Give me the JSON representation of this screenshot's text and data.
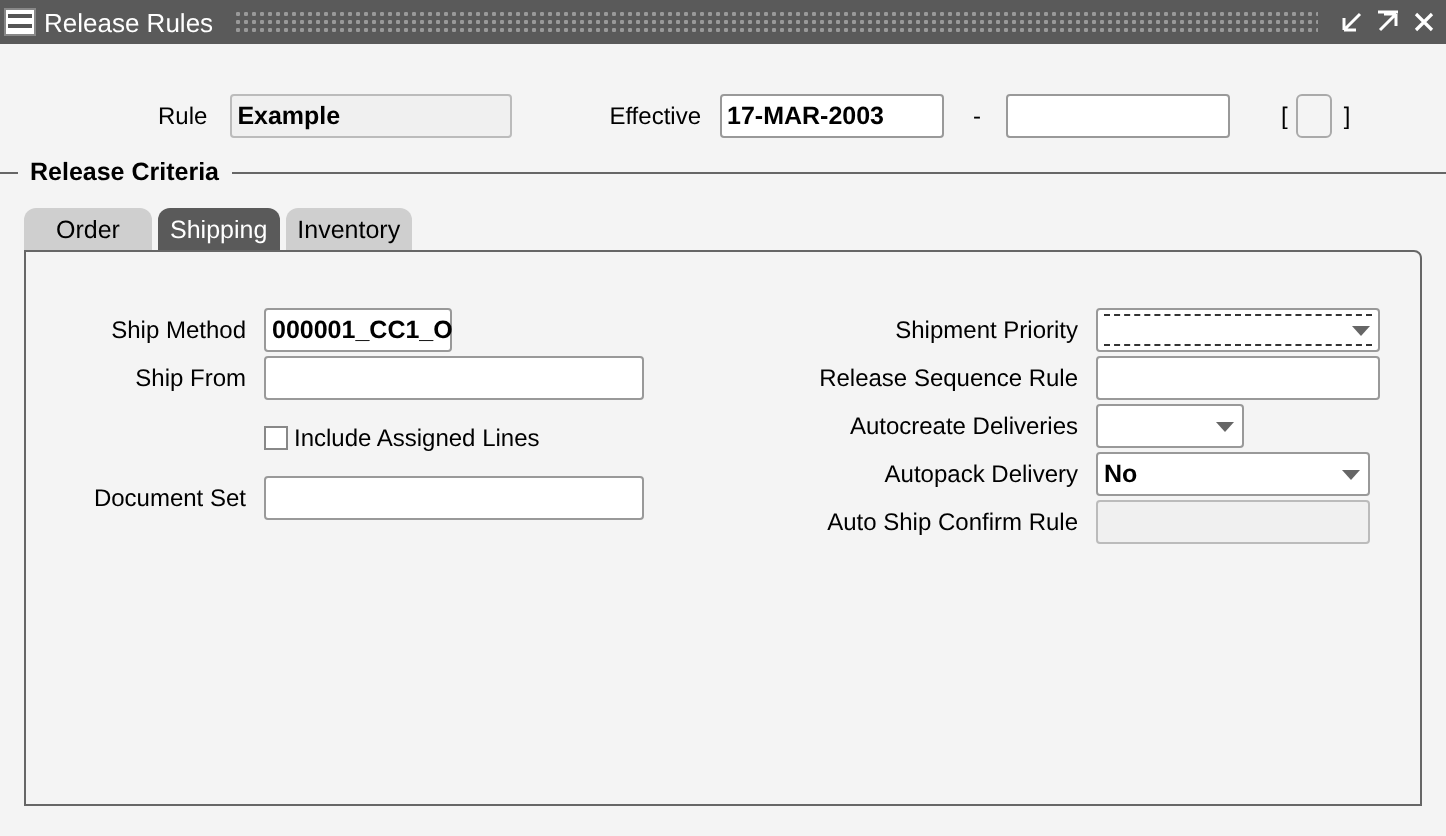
{
  "window": {
    "title": "Release Rules"
  },
  "header": {
    "rule": {
      "label": "Rule",
      "value": "Example",
      "disabled": true
    },
    "effective": {
      "label": "Effective",
      "from": "17-MAR-2003",
      "separator": "-"
    },
    "flex_open": "[",
    "flex_close": "]"
  },
  "section": {
    "title": "Release Criteria"
  },
  "tabs": [
    {
      "label": "Order",
      "selected": false
    },
    {
      "label": "Shipping",
      "selected": true
    },
    {
      "label": "Inventory",
      "selected": false
    }
  ],
  "left_fields": [
    {
      "kind": "text",
      "label": "Ship Method",
      "value": "000001_CC1_O",
      "disabled": false,
      "focused": false
    },
    {
      "kind": "text",
      "label": "Ship From",
      "disabled": false,
      "focused": false
    },
    {
      "kind": "checkbox",
      "label": "Include Assigned Lines",
      "checked": false
    },
    {
      "kind": "text",
      "label": "Document Set",
      "disabled": false,
      "focused": false
    }
  ],
  "right_fields": [
    {
      "kind": "dropdown",
      "label": "Shipment Priority",
      "disabled": false,
      "focused": true
    },
    {
      "kind": "text",
      "label": "Release Sequence Rule",
      "disabled": false,
      "focused": false
    },
    {
      "kind": "dropdown",
      "label": "Autocreate Deliveries",
      "disabled": false,
      "focused": false
    },
    {
      "kind": "dropdown",
      "label": "Autopack Delivery",
      "value": "No",
      "disabled": false,
      "focused": false
    },
    {
      "kind": "text",
      "label": "Auto Ship Confirm Rule",
      "disabled": true,
      "focused": false
    }
  ]
}
